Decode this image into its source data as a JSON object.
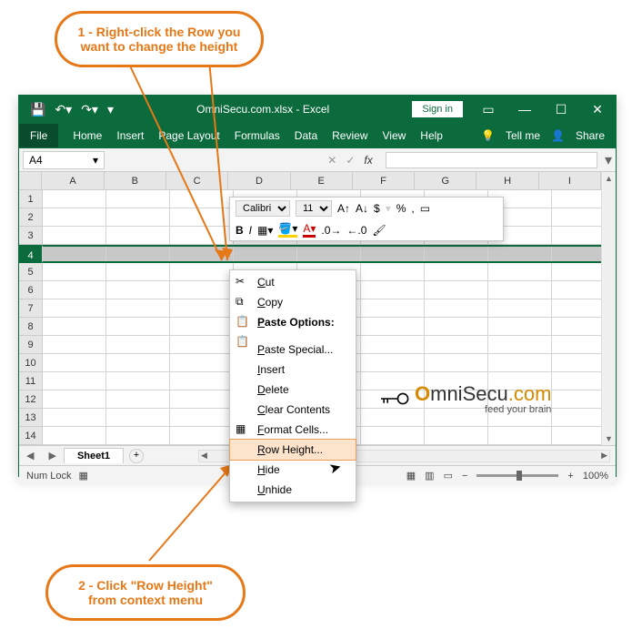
{
  "callouts": {
    "step1": "1 - Right-click the Row you want to change the height",
    "step2": "2 - Click \"Row Height\" from  context menu"
  },
  "titlebar": {
    "title": "OmniSecu.com.xlsx - Excel",
    "signin": "Sign in"
  },
  "ribbon": {
    "file": "File",
    "tabs": [
      "Home",
      "Insert",
      "Page Layout",
      "Formulas",
      "Data",
      "Review",
      "View",
      "Help"
    ],
    "tell_me": "Tell me",
    "share": "Share"
  },
  "formula_bar": {
    "name_box": "A4",
    "fx_label": "fx"
  },
  "grid": {
    "columns": [
      "A",
      "B",
      "C",
      "D",
      "E",
      "F",
      "G",
      "H",
      "I"
    ],
    "rows": [
      "1",
      "2",
      "3",
      "4",
      "5",
      "6",
      "7",
      "8",
      "9",
      "10",
      "11",
      "12",
      "13",
      "14"
    ],
    "selected_row": "4"
  },
  "sheet_tabs": {
    "active": "Sheet1"
  },
  "status_bar": {
    "left": "Num Lock",
    "zoom": "100%"
  },
  "mini_toolbar": {
    "font": "Calibri",
    "size": "11",
    "symbols": [
      "A↑",
      "A↓",
      "$",
      "%",
      ","
    ],
    "row2": [
      "B",
      "I"
    ]
  },
  "context_menu": {
    "items": [
      {
        "label": "Cut",
        "icon": "✂"
      },
      {
        "label": "Copy",
        "icon": "⧉"
      },
      {
        "label": "Paste Options:",
        "icon": "📋",
        "bold": true
      },
      {
        "label": "Paste Special..."
      },
      {
        "label": "Insert"
      },
      {
        "label": "Delete"
      },
      {
        "label": "Clear Contents"
      },
      {
        "label": "Format Cells...",
        "icon": "▦"
      },
      {
        "label": "Row Height...",
        "highlight": true
      },
      {
        "label": "Hide"
      },
      {
        "label": "Unhide"
      }
    ]
  },
  "watermark": {
    "brand_pre": "O",
    "brand_mid": "mniSecu",
    "brand_post": ".com",
    "sub": "feed your brain"
  }
}
